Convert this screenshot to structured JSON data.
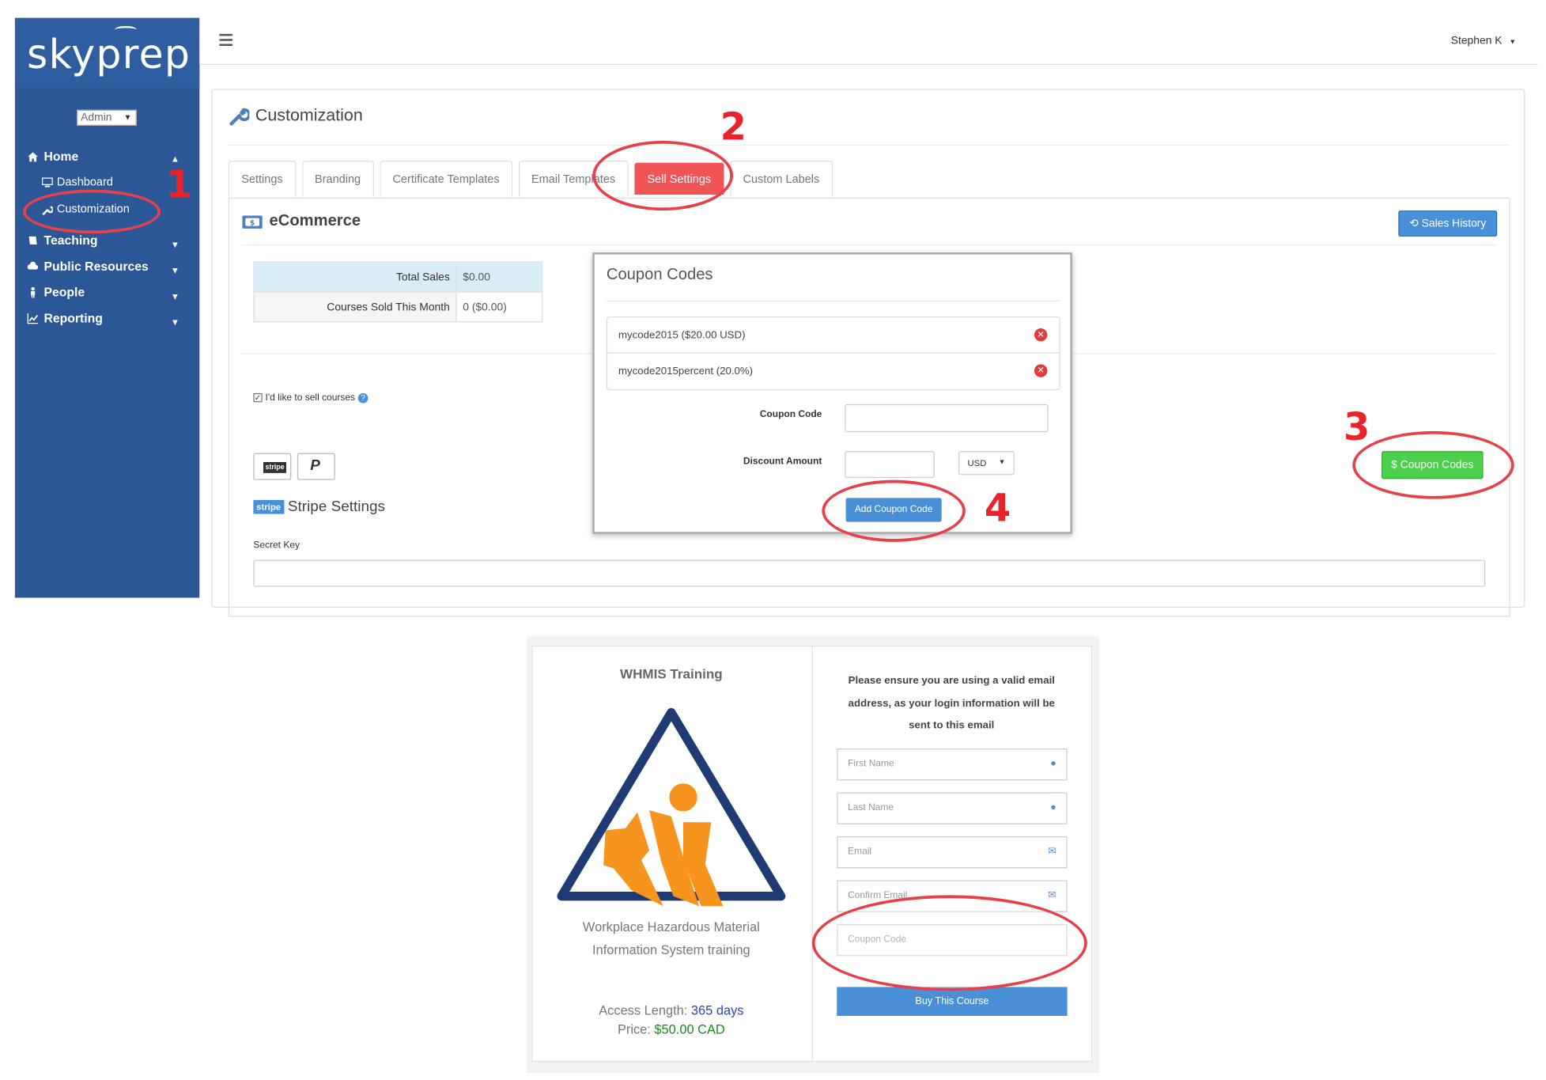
{
  "brand": {
    "logo_text": "skyprep"
  },
  "sidebar": {
    "role_selected": "Admin",
    "items": [
      {
        "label": "Home",
        "icon": "home-icon"
      },
      {
        "label": "Teaching",
        "icon": "book-icon"
      },
      {
        "label": "Public Resources",
        "icon": "cloud-icon"
      },
      {
        "label": "People",
        "icon": "person-icon"
      },
      {
        "label": "Reporting",
        "icon": "chart-icon"
      }
    ],
    "subitems": [
      {
        "label": "Dashboard",
        "icon": "monitor-icon"
      },
      {
        "label": "Customization",
        "icon": "wrench-icon"
      }
    ]
  },
  "header": {
    "user_name": "Stephen K"
  },
  "page": {
    "title": "Customization",
    "tabs": [
      "Settings",
      "Branding",
      "Certificate Templates",
      "Email Templates",
      "Sell Settings",
      "Custom Labels"
    ],
    "active_tab": "Sell Settings"
  },
  "ecommerce": {
    "title": "eCommerce",
    "sales_history_label": "Sales History",
    "stats": [
      {
        "label": "Total Sales",
        "value": "$0.00"
      },
      {
        "label": "Courses Sold This Month",
        "value": "0 ($0.00)"
      }
    ],
    "sell_checkbox_label": "I'd like to sell courses",
    "sell_checked": true,
    "stripe_badge": "stripe",
    "stripe_settings_title": "Stripe Settings",
    "secret_key_label": "Secret Key",
    "coupon_codes_button": "$ Coupon Codes"
  },
  "coupon_modal": {
    "title": "Coupon Codes",
    "codes": [
      "mycode2015 ($20.00 USD)",
      "mycode2015percent (20.0%)"
    ],
    "coupon_code_label": "Coupon Code",
    "discount_amount_label": "Discount Amount",
    "currency": "USD",
    "add_button": "Add Coupon Code"
  },
  "annotations": [
    "1",
    "2",
    "3",
    "4"
  ],
  "course_card": {
    "title": "WHMIS Training",
    "description_line1": "Workplace Hazardous Material",
    "description_line2": "Information System training",
    "access_label": "Access Length:",
    "access_value": "365 days",
    "price_label": "Price:",
    "price_value": "$50.00 CAD",
    "notice_line1": "Please ensure you are using a valid email",
    "notice_line2": "address, as your login information will be",
    "notice_line3": "sent to this email",
    "first_name_placeholder": "First Name",
    "last_name_placeholder": "Last Name",
    "email_placeholder": "Email",
    "confirm_email_placeholder": "Confirm Email",
    "coupon_placeholder": "Coupon Code",
    "buy_button": "Buy This Course"
  },
  "colors": {
    "sidebar_bg": "#2b5797",
    "active_tab": "#f05455",
    "primary_blue": "#4a90d9",
    "success_green": "#4cd04c",
    "annotation_red": "#e8242a",
    "logo_orange": "#f7941d",
    "logo_navy": "#1f3b73"
  }
}
